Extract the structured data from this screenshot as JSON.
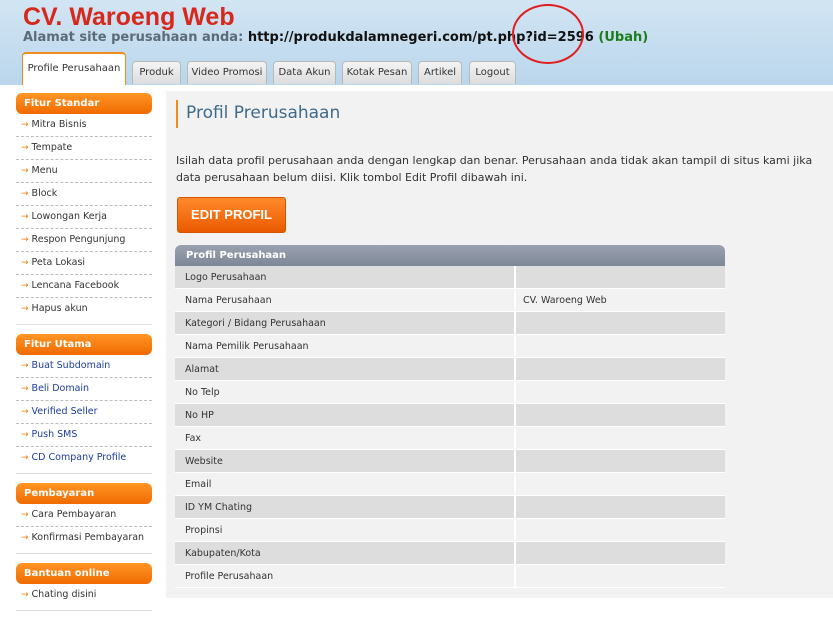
{
  "header": {
    "title": "CV. Waroeng Web",
    "url_label": "Alamat site perusahaan anda:",
    "url": "http://produkdalamnegeri.com/pt.php?id=2596",
    "change_link": "(Ubah)"
  },
  "tabs": [
    {
      "label": "Profile Perusahaan",
      "active": true
    },
    {
      "label": "Produk"
    },
    {
      "label": "Video Promosi"
    },
    {
      "label": "Data Akun"
    },
    {
      "label": "Kotak Pesan"
    },
    {
      "label": "Artikel"
    },
    {
      "label": "Logout"
    }
  ],
  "sidebar": {
    "standar": {
      "title": "Fitur Standar",
      "items": [
        "Mitra Bisnis",
        "Tempate",
        "Menu",
        "Block",
        "Lowongan Kerja",
        "Respon Pengunjung",
        "Peta Lokasi",
        "Lencana Facebook",
        "Hapus akun"
      ]
    },
    "utama": {
      "title": "Fitur Utama",
      "items": [
        "Buat Subdomain",
        "Beli Domain",
        "Verified Seller",
        "Push SMS",
        "CD Company Profile"
      ]
    },
    "pembayaran": {
      "title": "Pembayaran",
      "items": [
        "Cara Pembayaran",
        "Konfirmasi Pembayaran"
      ]
    },
    "bantuan": {
      "title": "Bantuan online",
      "items": [
        "Chating disini"
      ]
    },
    "arrow_glyph": "→"
  },
  "main": {
    "title": "Profil Prerusahaan",
    "intro": "Isilah data profil perusahaan anda dengan lengkap dan benar. Perusahaan anda tidak akan tampil di situs kami jika data perusahaan belum diisi. Klik tombol Edit Profil dibawah ini.",
    "edit_button": "EDIT PROFIL",
    "table": {
      "header": "Profil Perusahaan",
      "rows": [
        {
          "key": "Logo Perusahaan",
          "value": ""
        },
        {
          "key": "Nama Perusahaan",
          "value": "CV. Waroeng Web"
        },
        {
          "key": "Kategori / Bidang Perusahaan",
          "value": ""
        },
        {
          "key": "Nama Pemilik Perusahaan",
          "value": ""
        },
        {
          "key": "Alamat",
          "value": ""
        },
        {
          "key": "No Telp",
          "value": ""
        },
        {
          "key": "No HP",
          "value": ""
        },
        {
          "key": "Fax",
          "value": ""
        },
        {
          "key": "Website",
          "value": ""
        },
        {
          "key": "Email",
          "value": ""
        },
        {
          "key": "ID YM Chating",
          "value": ""
        },
        {
          "key": "Propinsi",
          "value": ""
        },
        {
          "key": "Kabupaten/Kota",
          "value": ""
        },
        {
          "key": "Profile Perusahaan",
          "value": ""
        }
      ]
    }
  }
}
